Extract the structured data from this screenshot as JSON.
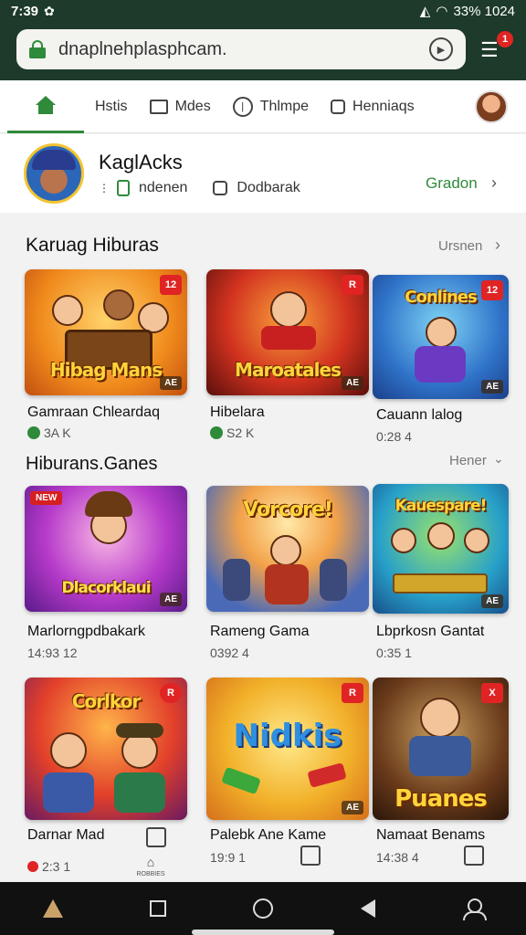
{
  "status_bar": {
    "time": "7:39",
    "right_text": "33% 1024"
  },
  "browser": {
    "url": "dnaplnehplasphcam.",
    "menu_badge": "1"
  },
  "tabs": [
    {
      "label": "Hstis"
    },
    {
      "label": "Mdes"
    },
    {
      "label": "Thlmpe"
    },
    {
      "label": "Henniaqs"
    }
  ],
  "profile": {
    "name": "KaglAcks",
    "meta_1": "ndenen",
    "meta_2": "Dodbarak",
    "action": "Gradon"
  },
  "section_1": {
    "title": "Karuag Hiburas",
    "link": "Ursnen",
    "items": [
      {
        "title": "Gamraan Chleardaq",
        "meta": "3A K",
        "art": "Hibag Mans",
        "badge": "12",
        "corner": "AE"
      },
      {
        "title": "Hibelara",
        "meta": "S2 K",
        "art": "Maroatales",
        "badge": "R",
        "corner": "AE"
      },
      {
        "title": "Cauann lalog",
        "meta": "0:28 4",
        "art": "Conlines",
        "badge": "12",
        "corner": "AE"
      }
    ]
  },
  "section_2": {
    "title": "Hiburans.Ganes",
    "link": "Hener",
    "items": [
      {
        "title": "Marlorngpdbakark",
        "meta": "14:93 12",
        "art": "Dlacorklaui",
        "badge": "NEW",
        "corner": "AE"
      },
      {
        "title": "Rameng Gama",
        "meta": "0392 4",
        "art": "Vorcore!",
        "badge": "",
        "corner": ""
      },
      {
        "title": "Lbprkosn Gantat",
        "meta": "0:35 1",
        "art": "Kauespare!",
        "badge": "",
        "corner": "AE"
      }
    ]
  },
  "section_3": {
    "items": [
      {
        "title": "Darnar Mad",
        "meta": "2:3 1",
        "art": "Corlkor",
        "badge": "R",
        "corner": "",
        "extra": "ROBBIES"
      },
      {
        "title": "Palebk Ane Kame",
        "meta": "19:9 1",
        "art": "Nidkis",
        "badge": "R",
        "corner": "AE"
      },
      {
        "title": "Namaat Benams",
        "meta": "14:38 4",
        "art": "Puanes",
        "badge": "X",
        "corner": ""
      }
    ]
  },
  "colors": {
    "accent": "#2f8a3a",
    "header_bg": "#1d3a2a",
    "badge_red": "#e02424"
  }
}
